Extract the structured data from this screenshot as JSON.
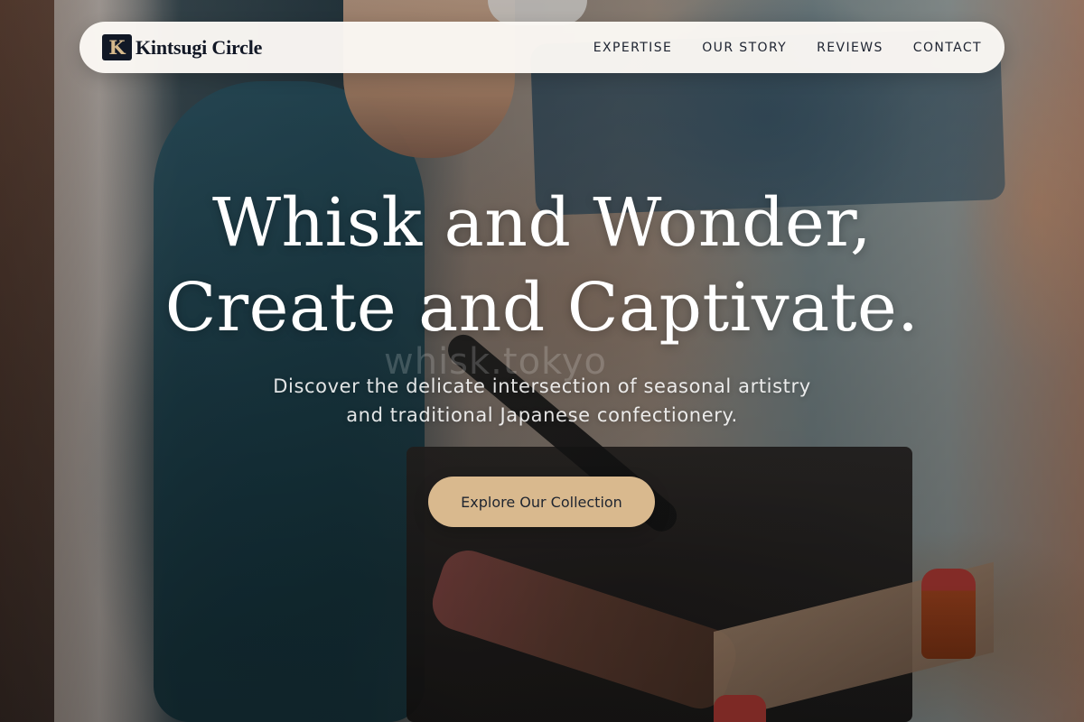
{
  "brand": {
    "mark": "K",
    "name": "Kintsugi Circle"
  },
  "nav": {
    "links": [
      {
        "label": "EXPERTISE"
      },
      {
        "label": "OUR STORY"
      },
      {
        "label": "REVIEWS"
      },
      {
        "label": "CONTACT"
      }
    ]
  },
  "hero": {
    "headline_lines": [
      "Whisk and Wonder,",
      "Create and Captivate."
    ],
    "subhead_lines": [
      "Discover the delicate intersection of seasonal artistry",
      "and traditional Japanese confectionery."
    ],
    "cta_label": "Explore Our Collection",
    "watermark": "whisk.tokyo",
    "background_image": "photo of a chef grilling skewers"
  },
  "colors": {
    "nav_background": "#FBF8F4",
    "brand_mark_background": "#111826",
    "brand_mark_text": "#D6B98C",
    "nav_text": "#1D2330",
    "cta_background": "#D9B98E",
    "cta_text": "#1F2530",
    "hero_text": "#FFFFFF"
  }
}
